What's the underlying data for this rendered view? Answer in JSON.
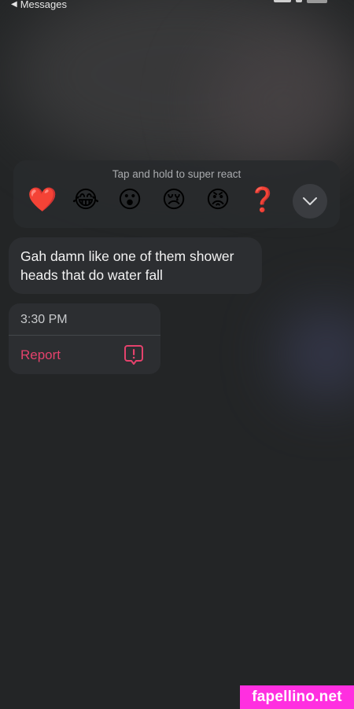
{
  "status_bar": {
    "back_label": "Messages"
  },
  "reactions": {
    "hint": "Tap and hold to super react",
    "emojis": [
      {
        "name": "heart",
        "glyph": "❤️"
      },
      {
        "name": "laugh",
        "glyph": "😂"
      },
      {
        "name": "wow",
        "glyph": "😮"
      },
      {
        "name": "sad",
        "glyph": "😢"
      },
      {
        "name": "angry",
        "glyph": "😡"
      },
      {
        "name": "question",
        "glyph": "❓"
      }
    ],
    "more_icon": "chevron-down-icon"
  },
  "message": {
    "text": "Gah damn like one of them shower heads that do water fall"
  },
  "context_menu": {
    "time": "3:30 PM",
    "report_label": "Report",
    "report_icon": "report-bubble-icon",
    "accent_color": "#e4426c"
  },
  "watermark": {
    "text": "fapellino.net"
  }
}
